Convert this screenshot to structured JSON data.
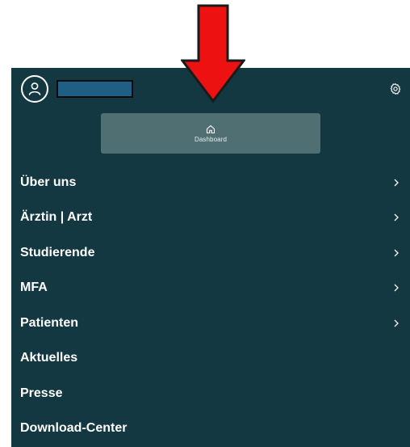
{
  "header": {
    "avatar_icon": "user-circle-icon",
    "username_redacted": true,
    "settings_icon": "gear-icon"
  },
  "dashboard": {
    "icon": "home-icon",
    "label": "Dashboard"
  },
  "menu": {
    "items": [
      {
        "label": "Über uns",
        "has_submenu": true
      },
      {
        "label": "Ärztin | Arzt",
        "has_submenu": true
      },
      {
        "label": "Studierende",
        "has_submenu": true
      },
      {
        "label": "MFA",
        "has_submenu": true
      },
      {
        "label": "Patienten",
        "has_submenu": true
      },
      {
        "label": "Aktuelles",
        "has_submenu": false
      },
      {
        "label": "Presse",
        "has_submenu": false
      },
      {
        "label": "Download-Center",
        "has_submenu": false
      }
    ]
  },
  "colors": {
    "panel_background": "#133842",
    "dashboard_card": "#4f6f73",
    "redaction_fill": "#1f5f86",
    "annotation_arrow": "#ee1111"
  },
  "annotation": {
    "icon": "down-arrow-icon"
  }
}
